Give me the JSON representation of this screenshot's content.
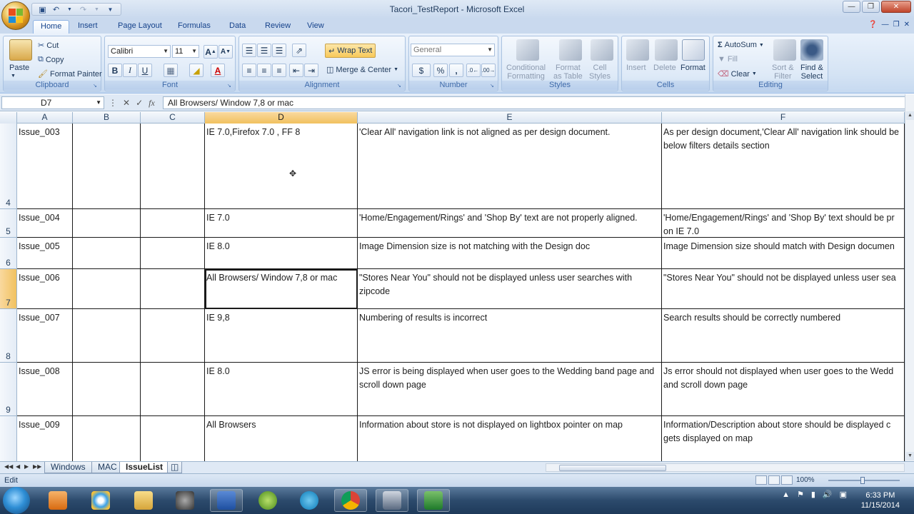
{
  "window": {
    "title": "Tacori_TestReport - Microsoft Excel"
  },
  "tabs": [
    "Home",
    "Insert",
    "Page Layout",
    "Formulas",
    "Data",
    "Review",
    "View"
  ],
  "ribbon": {
    "clipboard": {
      "label": "Clipboard",
      "paste": "Paste",
      "cut": "Cut",
      "copy": "Copy",
      "format_painter": "Format Painter"
    },
    "font": {
      "label": "Font",
      "family": "Calibri",
      "size": "11"
    },
    "alignment": {
      "label": "Alignment",
      "wrap_text": "Wrap Text",
      "merge": "Merge & Center"
    },
    "number": {
      "label": "Number",
      "format": "General",
      "currency": "$",
      "percent": "%",
      "comma": ","
    },
    "styles": {
      "label": "Styles",
      "conditional": "Conditional",
      "conditional2": "Formatting",
      "format_as": "Format",
      "format_as2": "as Table",
      "cell": "Cell",
      "cell2": "Styles"
    },
    "cells": {
      "label": "Cells",
      "insert": "Insert",
      "delete": "Delete",
      "format": "Format"
    },
    "editing": {
      "label": "Editing",
      "autosum": "AutoSum",
      "fill": "Fill",
      "clear": "Clear",
      "sort": "Sort &",
      "sort2": "Filter",
      "find": "Find &",
      "find2": "Select"
    }
  },
  "formula_bar": {
    "name_box": "D7",
    "fx": "fx",
    "content": "All Browsers/ Window 7,8 or mac"
  },
  "columns": [
    "A",
    "B",
    "C",
    "D",
    "E",
    "F"
  ],
  "rows": [
    {
      "num": "4",
      "A": "Issue_003",
      "D": "IE 7.0,Firefox 7.0 , FF 8",
      "E": "'Clear All' navigation link is not aligned as per design document.",
      "F": "As per design document,'Clear All' navigation link should be below filters details section"
    },
    {
      "num": "5",
      "A": "Issue_004",
      "D": "IE 7.0",
      "E": "'Home/Engagement/Rings' and 'Shop By' text are not properly aligned.",
      "F": "'Home/Engagement/Rings' and 'Shop By' text should be  pr on IE 7.0"
    },
    {
      "num": "6",
      "A": "Issue_005",
      "D": "IE 8.0",
      "E": "Image Dimension size is not matching with the Design doc",
      "F": "Image Dimension size should match with Design documen"
    },
    {
      "num": "7",
      "A": "Issue_006",
      "D": "All Browsers/ Window 7,8 or mac",
      "E": "\"Stores Near You\" should not be displayed unless user searches with zipcode",
      "F": "\"Stores Near You\" should not be displayed unless user sea"
    },
    {
      "num": "8",
      "A": "Issue_007",
      "D": "IE 9,8",
      "E": "Numbering of results is incorrect",
      "F": "Search results should be correctly numbered"
    },
    {
      "num": "9",
      "A": "Issue_008",
      "D": "IE 8.0",
      "E": "JS error is being displayed when user goes to the Wedding band page and scroll down page",
      "F": "Js error should not displayed when user goes to the Wedd and scroll down page"
    },
    {
      "num": "",
      "A": "Issue_009",
      "D": "All Browsers",
      "E": "Information about store is not displayed on lightbox pointer on map",
      "F": "Information/Description about store should be displayed c gets displayed on map"
    }
  ],
  "sheets": [
    "Windows",
    "MAC",
    "IssueList"
  ],
  "status": {
    "mode": "Edit",
    "zoom": "100%"
  },
  "clock": {
    "time": "6:33 PM",
    "date": "11/15/2014"
  },
  "colors": {
    "accent": "#15428b",
    "selected_header": "#f1c15f",
    "ribbon": "#d4e3f4"
  }
}
